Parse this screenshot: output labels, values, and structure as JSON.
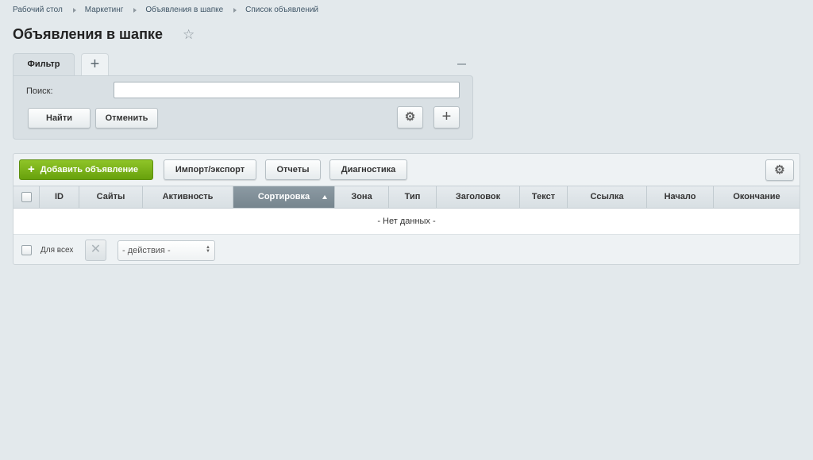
{
  "breadcrumb": [
    "Рабочий стол",
    "Маркетинг",
    "Объявления в шапке",
    "Список объявлений"
  ],
  "page_title": "Объявления в шапке",
  "filter": {
    "tab_label": "Фильтр",
    "add_tab_icon": "plus-icon",
    "search_label": "Поиск:",
    "search_value": "",
    "find_button": "Найти",
    "cancel_button": "Отменить"
  },
  "toolbar": {
    "add_button": "Добавить объявление",
    "import_export_button": "Импорт/экспорт",
    "reports_button": "Отчеты",
    "diagnostics_button": "Диагностика"
  },
  "table": {
    "columns": [
      "ID",
      "Сайты",
      "Активность",
      "Сортировка",
      "Зона",
      "Тип",
      "Заголовок",
      "Текст",
      "Ссылка",
      "Начало",
      "Окончание"
    ],
    "sorted_column": "Сортировка",
    "sort_direction": "asc",
    "empty_message": "- Нет данных -"
  },
  "footer": {
    "for_all_label": "Для всех",
    "actions_select": "- действия -"
  },
  "colors": {
    "accent_green": "#79b11a",
    "sorted_header": "#7f8d96",
    "background": "#e3e9ec"
  }
}
